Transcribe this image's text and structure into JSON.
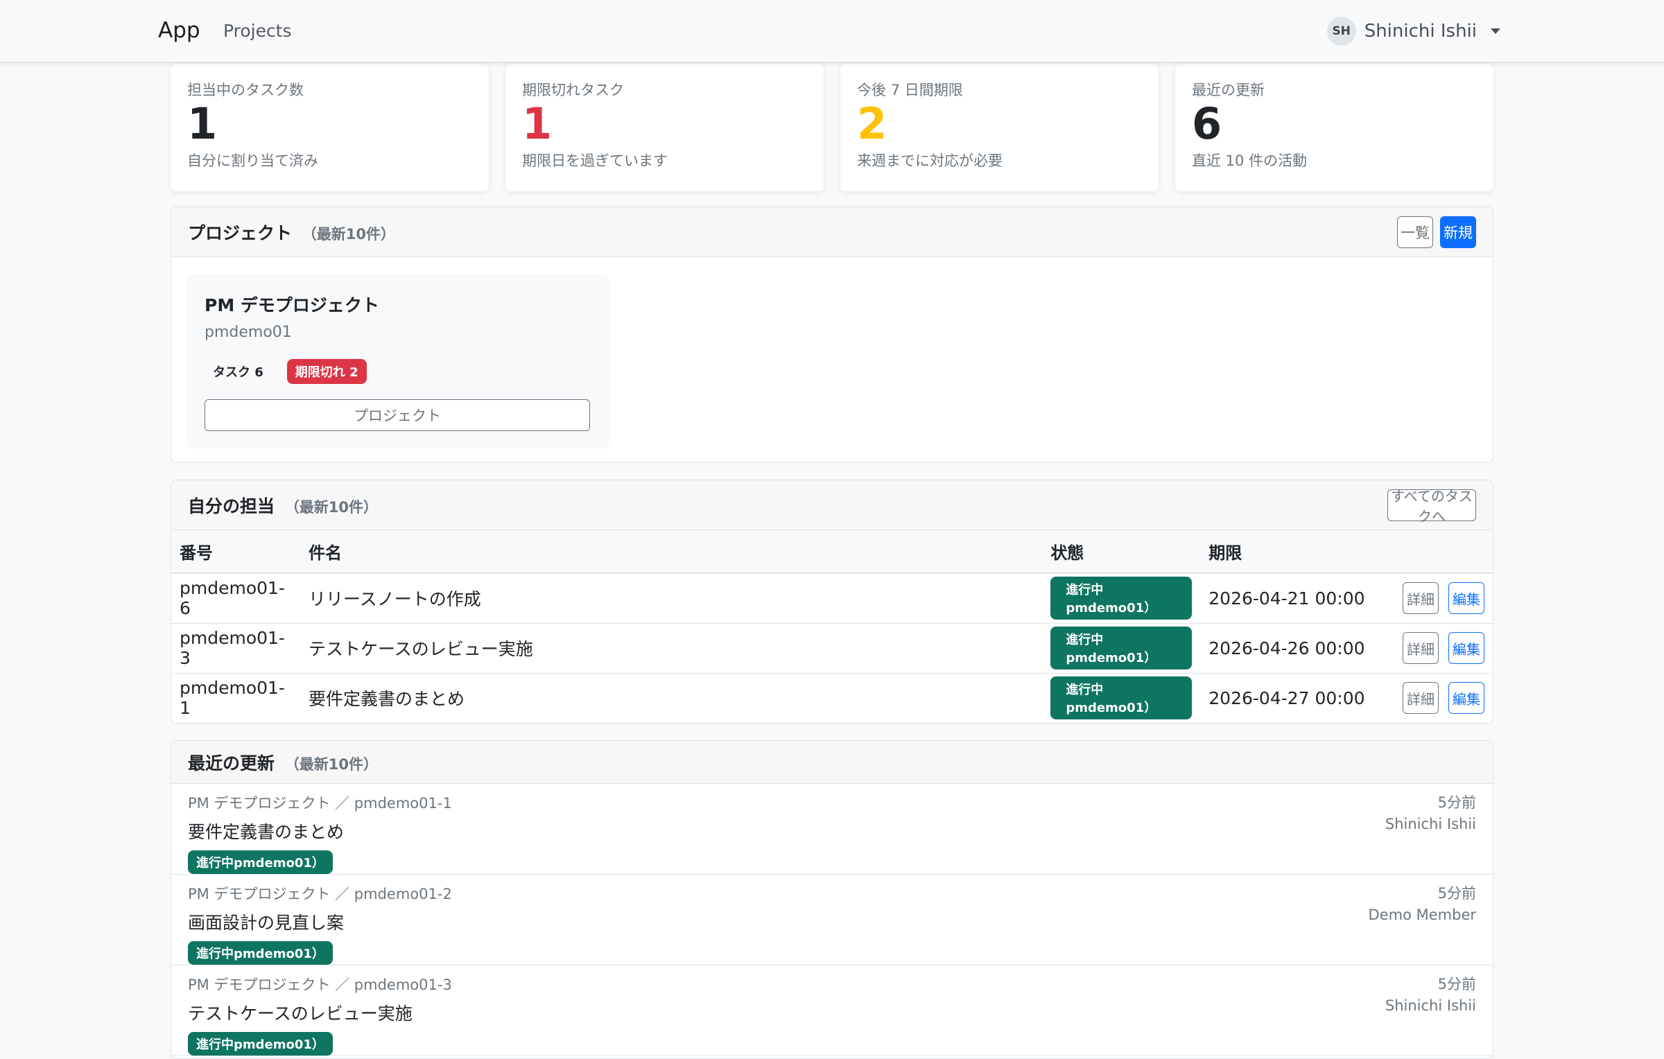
{
  "navbar": {
    "brand": "App",
    "nav_projects": "Projects",
    "user_initials": "SH",
    "user_name": "Shinichi Ishii"
  },
  "stats": [
    {
      "label": "担当中のタスク数",
      "value": "1",
      "sub": "自分に割り当て済み",
      "color": "#212529"
    },
    {
      "label": "期限切れタスク",
      "value": "1",
      "sub": "期限日を過ぎています",
      "color": "#dc3545"
    },
    {
      "label": "今後 7 日間期限",
      "value": "2",
      "sub": "来週までに対応が必要",
      "color": "#ffc107"
    },
    {
      "label": "最近の更新",
      "value": "6",
      "sub": "直近 10 件の活動",
      "color": "#212529"
    }
  ],
  "projects_section": {
    "title": "プロジェクト",
    "count": "（最新10件）",
    "btn_list": "一覧",
    "btn_new": "新規",
    "project": {
      "name": "PM デモプロジェクト",
      "key": "pmdemo01",
      "badge_tasks": "タスク 6",
      "badge_overdue": "期限切れ 2",
      "open_label": "プロジェクト"
    }
  },
  "tasks_section": {
    "title": "自分の担当",
    "count": "（最新10件）",
    "btn_all": "すべてのタスクへ",
    "columns": [
      "番号",
      "件名",
      "状態",
      "期限"
    ],
    "rows": [
      {
        "id": "pmdemo01-6",
        "title": "リリースノートの作成",
        "status": "進行中pmdemo01）",
        "due": "2026-04-21 00:00",
        "btn1": "詳細",
        "btn2": "編集"
      },
      {
        "id": "pmdemo01-3",
        "title": "テストケースのレビュー実施",
        "status": "進行中pmdemo01）",
        "due": "2026-04-26 00:00",
        "btn1": "詳細",
        "btn2": "編集"
      },
      {
        "id": "pmdemo01-1",
        "title": "要件定義書のまとめ",
        "status": "進行中pmdemo01）",
        "due": "2026-04-27 00:00",
        "btn1": "詳細",
        "btn2": "編集"
      }
    ]
  },
  "activity_section": {
    "title": "最近の更新",
    "count": "（最新10件）",
    "items": [
      {
        "context": "PM デモプロジェクト ／ pmdemo01-1",
        "title": "要件定義書のまとめ",
        "badge": "進行中pmdemo01）",
        "time": "5分前",
        "user": "Shinichi Ishii"
      },
      {
        "context": "PM デモプロジェクト ／ pmdemo01-2",
        "title": "画面設計の見直し案",
        "badge": "進行中pmdemo01）",
        "time": "5分前",
        "user": "Demo Member"
      },
      {
        "context": "PM デモプロジェクト ／ pmdemo01-3",
        "title": "テストケースのレビュー実施",
        "badge": "進行中pmdemo01）",
        "time": "5分前",
        "user": "Shinichi Ishii"
      }
    ]
  }
}
